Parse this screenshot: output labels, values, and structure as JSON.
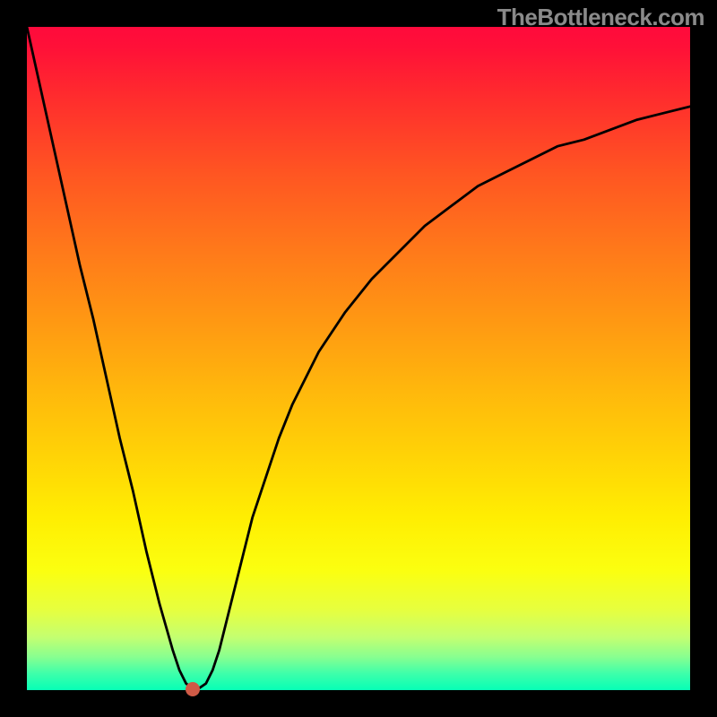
{
  "watermark": "TheBottleneck.com",
  "chart_data": {
    "type": "line",
    "title": "",
    "xlabel": "",
    "ylabel": "",
    "xlim": [
      0,
      100
    ],
    "ylim": [
      0,
      100
    ],
    "grid": false,
    "legend": false,
    "x": [
      0,
      2,
      4,
      6,
      8,
      10,
      12,
      14,
      16,
      18,
      20,
      22,
      23,
      24,
      25,
      26,
      27,
      28,
      29,
      30,
      31,
      32,
      33,
      34,
      36,
      38,
      40,
      44,
      48,
      52,
      56,
      60,
      64,
      68,
      72,
      76,
      80,
      84,
      88,
      92,
      96,
      100
    ],
    "y": [
      100,
      91,
      82,
      73,
      64,
      56,
      47,
      38,
      30,
      21,
      13,
      6,
      3,
      1,
      0.2,
      0.3,
      1,
      3,
      6,
      10,
      14,
      18,
      22,
      26,
      32,
      38,
      43,
      51,
      57,
      62,
      66,
      70,
      73,
      76,
      78,
      80,
      82,
      83,
      84.5,
      86,
      87,
      88
    ],
    "marker": {
      "x": 25,
      "y": 0.2
    },
    "background_gradient": {
      "stops": [
        {
          "pos": 0,
          "color": "#ff0a3c"
        },
        {
          "pos": 50,
          "color": "#ffb80c"
        },
        {
          "pos": 80,
          "color": "#fbff10"
        },
        {
          "pos": 100,
          "color": "#06ffb6"
        }
      ]
    }
  }
}
